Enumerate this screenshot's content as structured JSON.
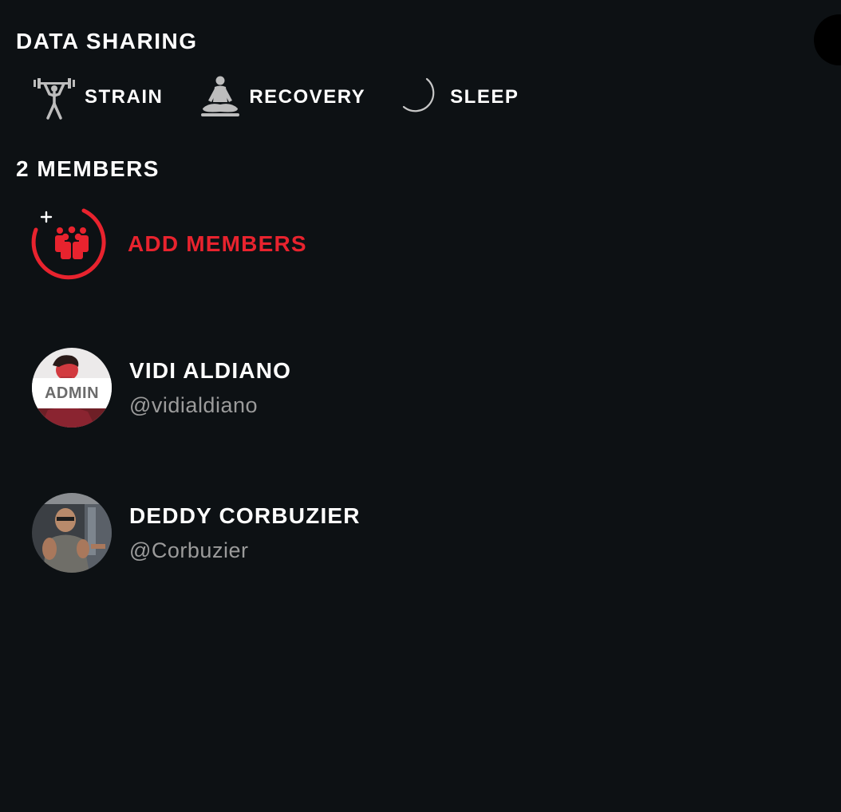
{
  "data_sharing": {
    "title": "DATA SHARING",
    "items": [
      {
        "label": "STRAIN",
        "icon": "weightlifter-icon"
      },
      {
        "label": "RECOVERY",
        "icon": "meditation-icon"
      },
      {
        "label": "SLEEP",
        "icon": "moon-icon"
      }
    ]
  },
  "members": {
    "title": "2 MEMBERS",
    "add_label": "ADD MEMBERS",
    "add_icon": "add-group-icon",
    "accent_color": "#e8232e",
    "list": [
      {
        "name": "VIDI ALDIANO",
        "handle": "@vidialdiano",
        "badge": "ADMIN"
      },
      {
        "name": "DEDDY CORBUZIER",
        "handle": "@Corbuzier"
      }
    ]
  }
}
